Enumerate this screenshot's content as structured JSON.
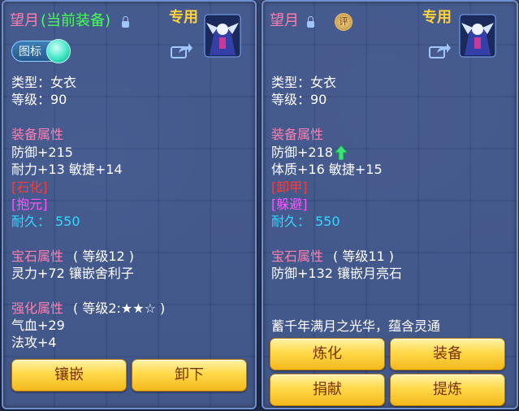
{
  "left_panel": {
    "item_name": "望月",
    "equipped_tag": "(当前装备)",
    "exclusive_tag": "专用",
    "icon_toggle_label": "图标",
    "type_line": "类型：女衣",
    "level_line": "等级：90",
    "attr_header": "装备属性",
    "defense": "防御+215",
    "stats_line": "耐力+13 敏捷+14",
    "special_1": "[石化]",
    "special_2": "[抱元]",
    "durability_label": "耐久：",
    "durability_value": "550",
    "gem_header": "宝石属性",
    "gem_level": "( 等级12 )",
    "gem_line": "灵力+72 镶嵌舍利子",
    "forge_header": "强化属性",
    "forge_level": "( 等级2:★★☆ )",
    "forge_line_1": "气血+29",
    "forge_line_2": "法攻+4",
    "buttons": {
      "inlay": "镶嵌",
      "unequip": "卸下"
    }
  },
  "right_panel": {
    "item_name": "望月",
    "appraise_badge": "评",
    "exclusive_tag": "专用",
    "type_line": "类型：女衣",
    "level_line": "等级：90",
    "attr_header": "装备属性",
    "defense": "防御+218",
    "stats_line": "体质+16 敏捷+15",
    "special_1": "[卸甲]",
    "special_2": "[躲避]",
    "durability_label": "耐久：",
    "durability_value": "550",
    "gem_header": "宝石属性",
    "gem_level": "( 等级11 )",
    "gem_line": "防御+132 镶嵌月亮石",
    "description": "蓄千年满月之光华，蕴含灵通",
    "buttons": {
      "refine": "炼化",
      "equip": "装备",
      "donate": "捐献",
      "extract": "提炼"
    }
  },
  "colors": {
    "name": "#ff7fb0",
    "equipped": "#48ff5a",
    "exclusive": "#ffd23a",
    "section": "#ff7fb0",
    "special_red": "#ff3a3a",
    "special_magenta": "#ff55ff",
    "durability": "#33d8ff",
    "button_text": "#7a3200"
  },
  "icons": [
    "lock-icon",
    "share-icon",
    "character-portrait-icon",
    "appraise-badge-icon",
    "upgrade-arrow-icon"
  ]
}
